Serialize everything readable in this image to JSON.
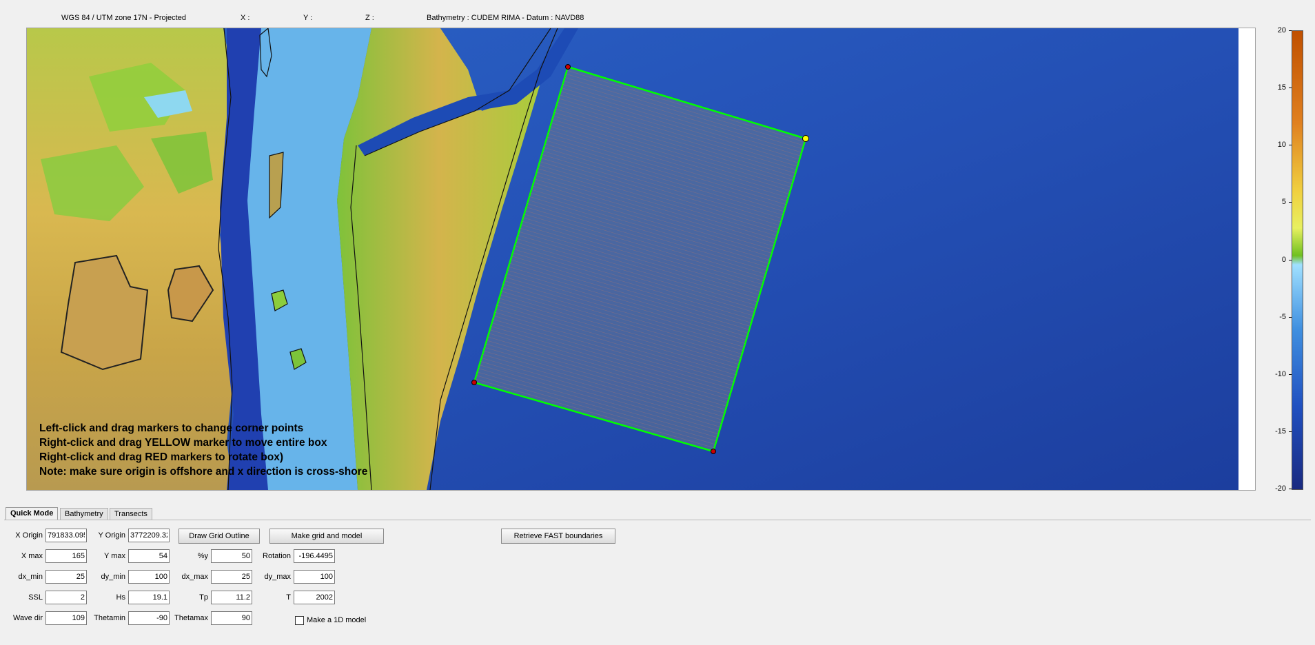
{
  "status_bar": {
    "projection": "WGS 84 / UTM zone 17N - Projected",
    "x_label": "X :",
    "y_label": "Y :",
    "z_label": "Z :",
    "bathymetry_info": "Bathymetry : CUDEM RIMA   -   Datum : NAVD88"
  },
  "map": {
    "instructions": [
      "Left-click and drag markers to change corner points",
      "Right-click and drag YELLOW marker to move entire box",
      "Right-click and drag RED markers to rotate box)",
      "Note: make sure origin is offshore and x direction is cross-shore"
    ],
    "marker_colors": {
      "yellow": "#ffff00",
      "red": "#cc0000",
      "outline": "#00ff00"
    }
  },
  "colorbar": {
    "ticks": [
      "20",
      "15",
      "10",
      "5",
      "0",
      "-5",
      "-10",
      "-15",
      "-20"
    ],
    "top_color": "#c05000",
    "bottom_color": "#1a2a80"
  },
  "tabs": [
    {
      "label": "Quick Mode",
      "active": true
    },
    {
      "label": "Bathymetry",
      "active": false
    },
    {
      "label": "Transects",
      "active": false
    }
  ],
  "form": {
    "x_origin": {
      "label": "X Origin",
      "value": "791833.095"
    },
    "y_origin": {
      "label": "Y Origin",
      "value": "3772209.32"
    },
    "x_max": {
      "label": "X max",
      "value": "165"
    },
    "y_max": {
      "label": "Y max",
      "value": "54"
    },
    "pct_y": {
      "label": "%y",
      "value": "50"
    },
    "rotation": {
      "label": "Rotation",
      "value": "-196.4495"
    },
    "dx_min": {
      "label": "dx_min",
      "value": "25"
    },
    "dy_min": {
      "label": "dy_min",
      "value": "100"
    },
    "dx_max": {
      "label": "dx_max",
      "value": "25"
    },
    "dy_max": {
      "label": "dy_max",
      "value": "100"
    },
    "ssl": {
      "label": "SSL",
      "value": "2"
    },
    "hs": {
      "label": "Hs",
      "value": "19.1"
    },
    "tp": {
      "label": "Tp",
      "value": "11.2"
    },
    "t": {
      "label": "T",
      "value": "2002"
    },
    "wave_dir": {
      "label": "Wave dir",
      "value": "109"
    },
    "thetamin": {
      "label": "Thetamin",
      "value": "-90"
    },
    "thetamax": {
      "label": "Thetamax",
      "value": "90"
    }
  },
  "buttons": {
    "draw_grid": "Draw Grid Outline",
    "make_grid": "Make grid and model",
    "retrieve_fast": "Retrieve FAST boundaries"
  },
  "checkbox": {
    "label": "Make a 1D model",
    "checked": false
  }
}
